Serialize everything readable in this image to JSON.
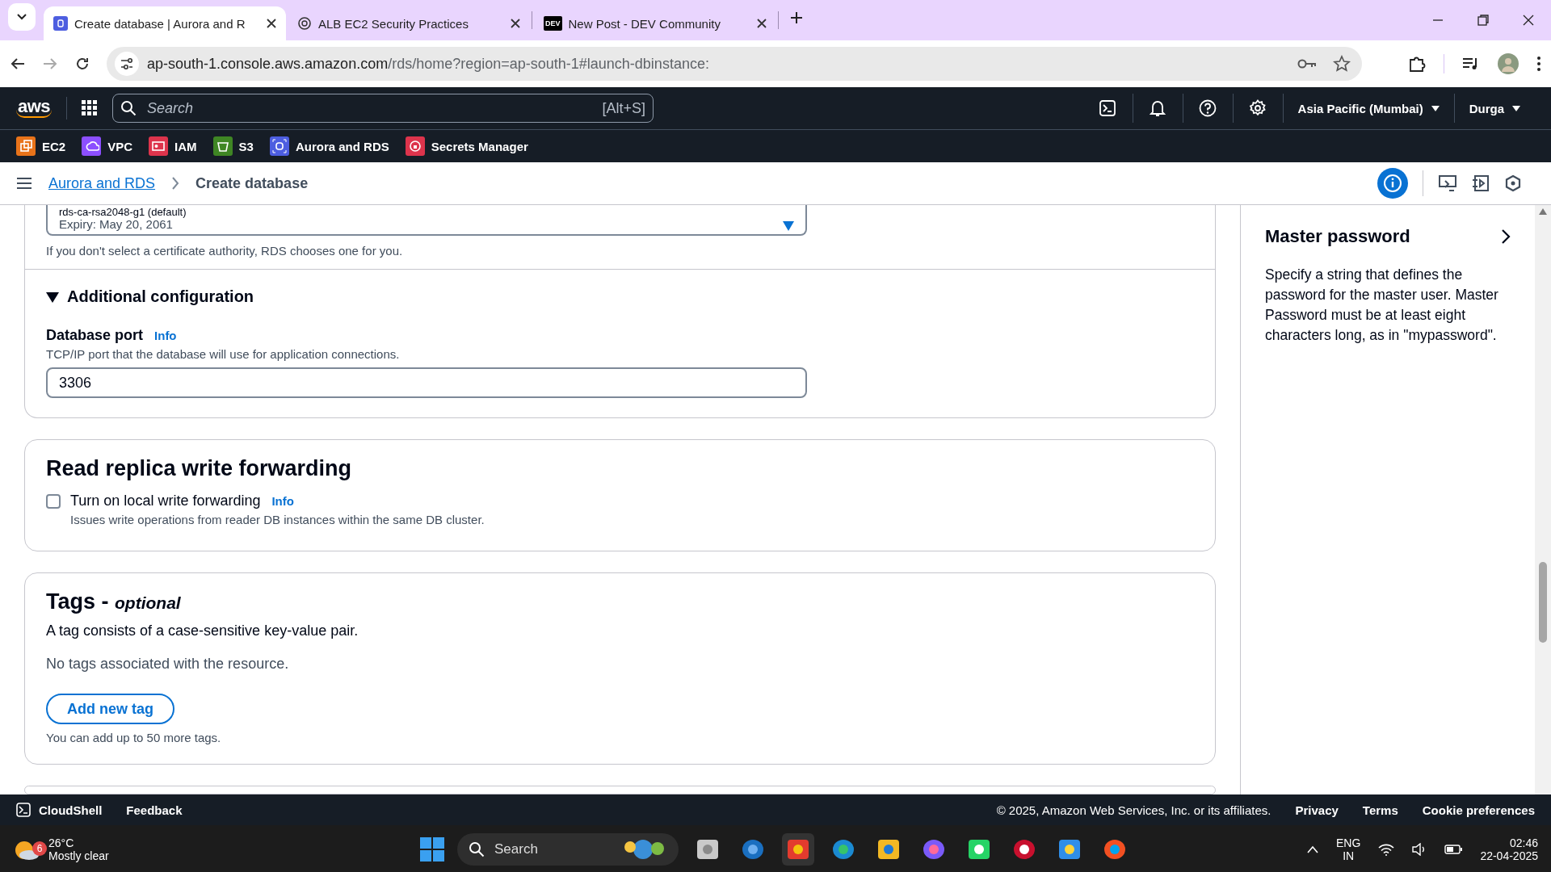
{
  "browser": {
    "tabs": [
      {
        "title": "Create database | Aurora and R",
        "selected": true,
        "kind": "aws"
      },
      {
        "title": "ALB EC2 Security Practices",
        "selected": false,
        "kind": "chat"
      },
      {
        "title": "New Post - DEV Community",
        "selected": false,
        "kind": "dev"
      }
    ],
    "dev_logo": "DEV",
    "url_host": "ap-south-1.console.aws.amazon.com",
    "url_path": "/rds/home?region=ap-south-1#launch-dbinstance:"
  },
  "aws_nav": {
    "logo": "aws",
    "search_placeholder": "Search",
    "shortcut": "[Alt+S]",
    "region": "Asia Pacific (Mumbai)",
    "user": "Durga"
  },
  "favorites": [
    {
      "label": "EC2",
      "color": "#e8731a"
    },
    {
      "label": "VPC",
      "color": "#8c4fff"
    },
    {
      "label": "IAM",
      "color": "#dd344c"
    },
    {
      "label": "S3",
      "color": "#3f8624"
    },
    {
      "label": "Aurora and RDS",
      "color": "#4d5ee0"
    },
    {
      "label": "Secrets Manager",
      "color": "#dd344c"
    }
  ],
  "breadcrumb": {
    "link": "Aurora and RDS",
    "current": "Create database"
  },
  "certificate": {
    "value": "rds-ca-rsa2048-g1 (default)",
    "expiry": "Expiry: May 20, 2061",
    "hint": "If you don't select a certificate authority, RDS chooses one for you."
  },
  "additional_config": {
    "title": "Additional configuration",
    "expanded": true,
    "port_label": "Database port",
    "info": "Info",
    "port_hint": "TCP/IP port that the database will use for application connections.",
    "port_value": "3306"
  },
  "write_forwarding": {
    "title": "Read replica write forwarding",
    "checkbox_label": "Turn on local write forwarding",
    "checked": false,
    "info": "Info",
    "description": "Issues write operations from reader DB instances within the same DB cluster."
  },
  "tags": {
    "title": "Tags -",
    "optional": "optional",
    "description": "A tag consists of a case-sensitive key-value pair.",
    "empty": "No tags associated with the resource.",
    "button": "Add new tag",
    "hint": "You can add up to 50 more tags."
  },
  "help_panel": {
    "title": "Master password",
    "body": "Specify a string that defines the password for the master user. Master Password must be at least eight characters long, as in \"mypassword\"."
  },
  "footer": {
    "cloudshell": "CloudShell",
    "feedback": "Feedback",
    "copyright": "© 2025, Amazon Web Services, Inc. or its affiliates.",
    "links": [
      "Privacy",
      "Terms",
      "Cookie preferences"
    ]
  },
  "taskbar": {
    "badge": "6",
    "temperature": "26°C",
    "condition": "Mostly clear",
    "search": "Search",
    "language": "ENG",
    "locale": "IN",
    "time": "02:46",
    "date": "22-04-2025"
  }
}
